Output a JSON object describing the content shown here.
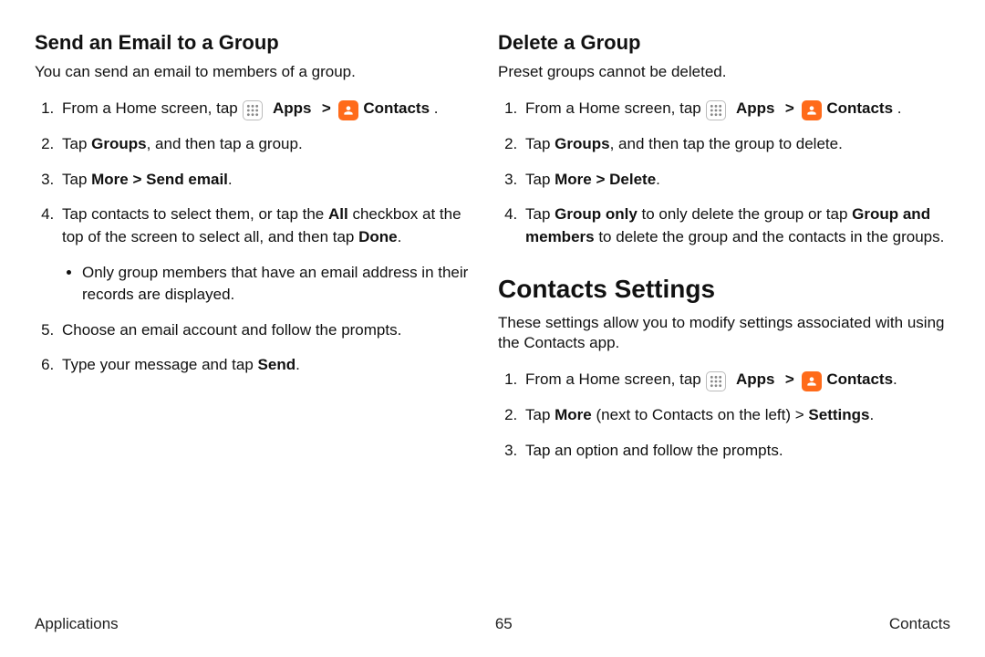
{
  "left": {
    "heading": "Send an Email to a Group",
    "intro": "You can send an email to members of a group.",
    "step1_a": "From a Home screen, tap ",
    "apps": "Apps",
    "contacts": "Contacts",
    "step2_a": "Tap ",
    "step2_groups": "Groups",
    "step2_b": ", and then tap a group.",
    "step3_a": "Tap ",
    "step3_more": "More",
    "step3_b": " > ",
    "step3_send": "Send email",
    "step3_c": ".",
    "step4_a": "Tap contacts to select them, or tap the ",
    "step4_all": "All",
    "step4_b": " checkbox at the top of the screen to select all, and then tap ",
    "step4_done": "Done",
    "step4_c": ".",
    "step4_bullet": "Only group members that have an email address in their records are displayed.",
    "step5": "Choose an email account and follow the prompts.",
    "step6_a": "Type your message and tap ",
    "step6_send": "Send",
    "step6_b": "."
  },
  "right": {
    "heading": "Delete a Group",
    "intro": "Preset groups cannot be deleted.",
    "step1_a": "From a Home screen, tap ",
    "apps": "Apps",
    "contacts": "Contacts",
    "step2_a": "Tap ",
    "step2_groups": "Groups",
    "step2_b": ", and then tap the group to delete.",
    "step3_a": "Tap ",
    "step3_more": "More",
    "step3_b": " > ",
    "step3_delete": "Delete",
    "step3_c": ".",
    "step4_a": "Tap ",
    "step4_go": "Group only",
    "step4_b": " to only delete the group or tap ",
    "step4_gm": "Group and members",
    "step4_c": " to delete the group and the contacts in the groups.",
    "h1": "Contacts Settings",
    "intro2": "These settings allow you to modify settings associated with using the Contacts app.",
    "c_step1_a": "From a Home screen, tap ",
    "c_step2_a": "Tap ",
    "c_step2_more": "More",
    "c_step2_b": " (next to Contacts on the left) > ",
    "c_step2_settings": "Settings",
    "c_step2_c": ".",
    "c_step3": "Tap an option and follow the prompts."
  },
  "footer": {
    "left": "Applications",
    "page": "65",
    "right": "Contacts"
  },
  "chev": ">"
}
